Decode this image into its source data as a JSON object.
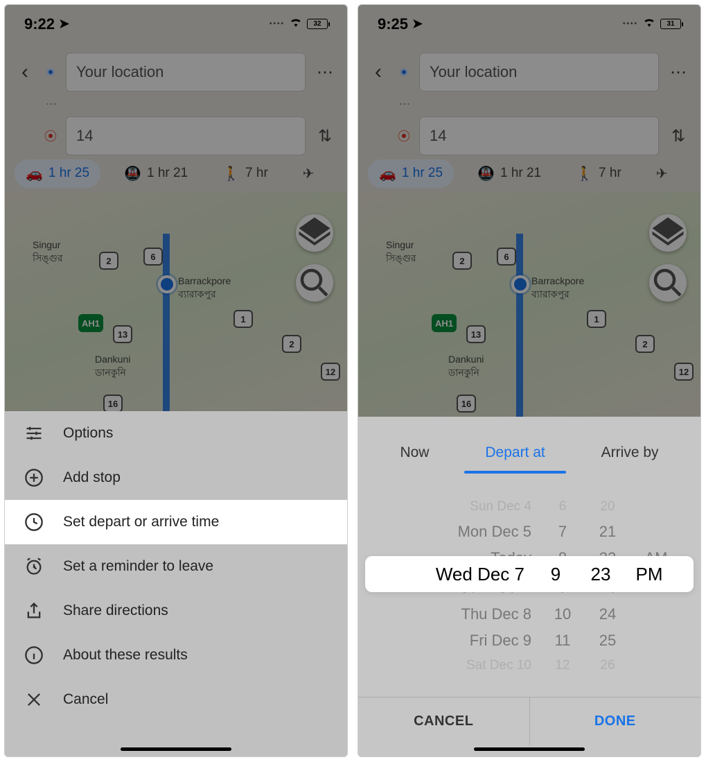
{
  "left": {
    "status_time": "9:22",
    "battery": "32",
    "origin": "Your location",
    "destination": "14",
    "modes": {
      "drive": "1 hr 25",
      "transit": "1 hr 21",
      "walk": "7 hr",
      "flight": ""
    },
    "map": {
      "city": "Barrackpore",
      "city_local": "ব্যারাকপুর",
      "singur": "Singur",
      "singur_local": "সিঙ্গুর",
      "dankuni": "Dankuni",
      "dankuni_local": "ডানকুনি",
      "shields": [
        "6",
        "1",
        "2",
        "13",
        "2",
        "16",
        "12"
      ],
      "ah": "AH1"
    },
    "menu": {
      "options": "Options",
      "add_stop": "Add stop",
      "set_time": "Set depart or arrive time",
      "reminder": "Set a reminder to leave",
      "share": "Share directions",
      "about": "About these results",
      "cancel": "Cancel"
    }
  },
  "right": {
    "status_time": "9:25",
    "battery": "31",
    "origin": "Your location",
    "destination": "14",
    "modes": {
      "drive": "1 hr 25",
      "transit": "1 hr 21",
      "walk": "7 hr",
      "flight": ""
    },
    "tabs": {
      "now": "Now",
      "depart": "Depart at",
      "arrive": "Arrive by"
    },
    "picker": {
      "dates": [
        "Sun Dec 4",
        "Mon Dec 5",
        "Today",
        "Wed Dec 7",
        "Thu Dec 8",
        "Fri Dec 9",
        "Sat Dec 10"
      ],
      "hours": [
        "6",
        "7",
        "8",
        "9",
        "10",
        "11",
        "12"
      ],
      "minutes": [
        "20",
        "21",
        "22",
        "23",
        "24",
        "25",
        "26"
      ],
      "ampm": [
        "AM",
        "PM"
      ],
      "selected_date": "Wed Dec 7",
      "selected_hour": "9",
      "selected_minute": "23",
      "selected_ampm": "PM"
    },
    "actions": {
      "cancel": "CANCEL",
      "done": "DONE"
    }
  }
}
